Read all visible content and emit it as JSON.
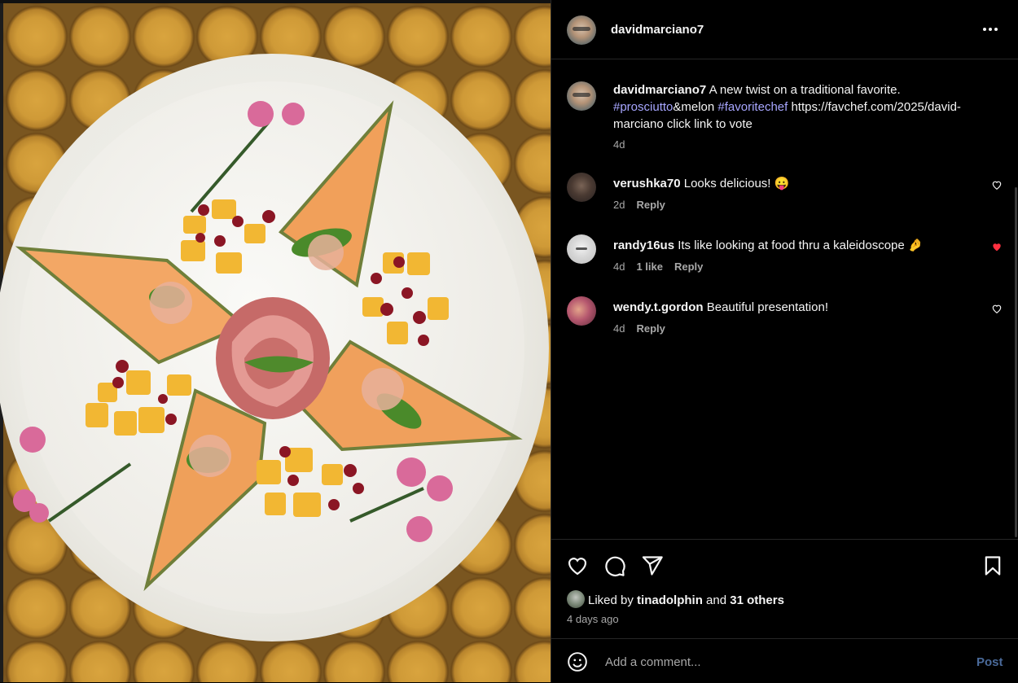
{
  "post": {
    "username": "davidmarciano7",
    "more_label": "•••"
  },
  "caption": {
    "username": "davidmarciano7",
    "text_before": "A new twist on a traditional favorite.",
    "tag1": "#prosciutto",
    "mid": "&melon",
    "tag2": "#favoritechef",
    "text_after": "https://favchef.com/2025/david-marciano click link to vote",
    "time": "4d"
  },
  "comments": [
    {
      "username": "verushka70",
      "text": "Looks delicious! 😛",
      "time": "2d",
      "likes": "",
      "reply": "Reply",
      "liked": false
    },
    {
      "username": "randy16us",
      "text": "Its like looking at food thru a kaleidoscope 🤌",
      "time": "4d",
      "likes": "1 like",
      "reply": "Reply",
      "liked": true
    },
    {
      "username": "wendy.t.gordon",
      "text": "Beautiful presentation!",
      "time": "4d",
      "likes": "",
      "reply": "Reply",
      "liked": false
    }
  ],
  "likes": {
    "prefix": "Liked by",
    "user": "tinadolphin",
    "and": "and",
    "others": "31 others"
  },
  "date": "4 days ago",
  "comment_box": {
    "placeholder": "Add a comment...",
    "post_label": "Post"
  },
  "colors": {
    "background": "#000000",
    "heart_liked": "#ff3040",
    "hashtag": "#a7a6ff",
    "post_disabled": "#4a6a9a"
  },
  "icons": [
    "more-icon",
    "like-icon",
    "comment-icon",
    "share-icon",
    "save-icon",
    "emoji-icon",
    "heart-icon"
  ]
}
